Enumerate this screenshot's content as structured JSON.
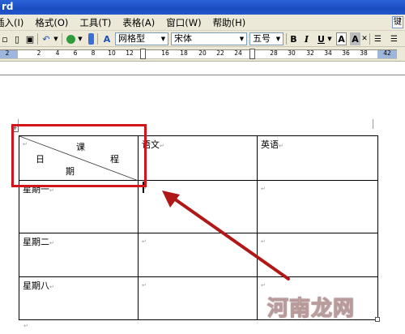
{
  "window": {
    "title_fragment": "rd"
  },
  "menu": {
    "items": [
      "插入(I)",
      "格式(O)",
      "工具(T)",
      "表格(A)",
      "窗口(W)",
      "帮助(H)"
    ],
    "help_box": "键"
  },
  "toolbar": {
    "style_combo": "网格型",
    "font_combo": "宋体",
    "size_combo": "五号",
    "bold": "B",
    "italic": "I",
    "underline": "U",
    "font_a": "A",
    "font_a2": "A"
  },
  "ruler": {
    "ticks": [
      "2",
      "2",
      "4",
      "6",
      "8",
      "10",
      "12",
      "16",
      "18",
      "20",
      "22",
      "24",
      "28",
      "30",
      "32",
      "34",
      "36",
      "38",
      "42"
    ]
  },
  "table": {
    "header_diagonal": {
      "ke": "课",
      "cheng": "程",
      "ri": "日",
      "qi": "期"
    },
    "header_cells": [
      "语文",
      "英语"
    ],
    "row_labels": [
      "星期一",
      "星期二",
      "星期八"
    ]
  },
  "watermark": "河南龙网",
  "colors": {
    "highlight": "#d2141c",
    "arrow": "#b01818",
    "titlebar": "#2b63d6"
  }
}
